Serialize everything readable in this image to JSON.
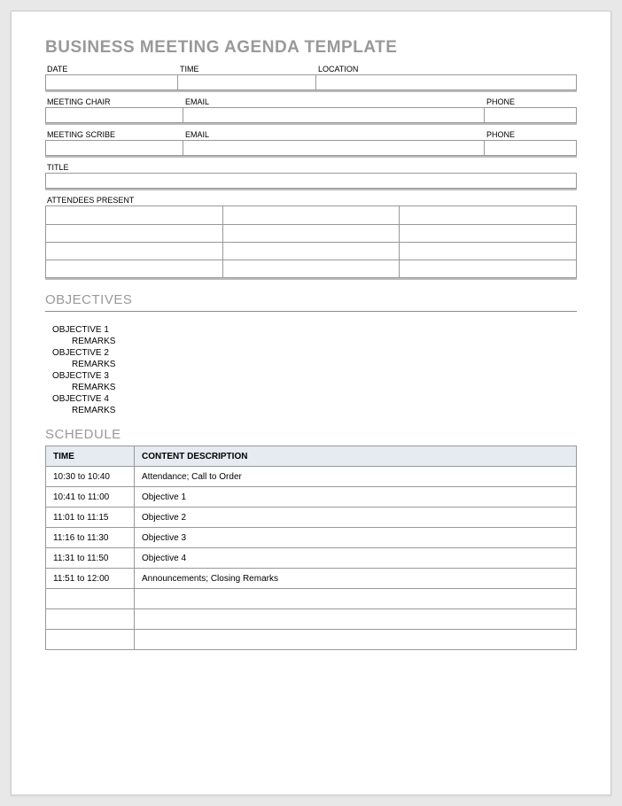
{
  "title": "BUSINESS MEETING AGENDA TEMPLATE",
  "header": {
    "date_label": "DATE",
    "time_label": "TIME",
    "location_label": "LOCATION",
    "date": "",
    "time": "",
    "location": "",
    "chair_label": "MEETING CHAIR",
    "email_label": "EMAIL",
    "phone_label": "PHONE",
    "chair": "",
    "chair_email": "",
    "chair_phone": "",
    "scribe_label": "MEETING SCRIBE",
    "scribe": "",
    "scribe_email": "",
    "scribe_phone": "",
    "title_label": "TITLE",
    "title_value": "",
    "attendees_label": "ATTENDEES PRESENT"
  },
  "objectives_heading": "OBJECTIVES",
  "objectives": [
    {
      "name": "OBJECTIVE 1",
      "remarks_label": "REMARKS"
    },
    {
      "name": "OBJECTIVE 2",
      "remarks_label": "REMARKS"
    },
    {
      "name": "OBJECTIVE 3",
      "remarks_label": "REMARKS"
    },
    {
      "name": "OBJECTIVE 4",
      "remarks_label": "REMARKS"
    }
  ],
  "schedule_heading": "SCHEDULE",
  "schedule": {
    "col_time": "TIME",
    "col_desc": "CONTENT DESCRIPTION",
    "rows": [
      {
        "time": "10:30 to 10:40",
        "desc": "Attendance; Call to Order"
      },
      {
        "time": "10:41 to 11:00",
        "desc": "Objective 1"
      },
      {
        "time": "11:01 to 11:15",
        "desc": "Objective 2"
      },
      {
        "time": "11:16 to 11:30",
        "desc": "Objective 3"
      },
      {
        "time": "11:31 to 11:50",
        "desc": "Objective 4"
      },
      {
        "time": "11:51 to 12:00",
        "desc": "Announcements; Closing Remarks"
      },
      {
        "time": "",
        "desc": ""
      },
      {
        "time": "",
        "desc": ""
      },
      {
        "time": "",
        "desc": ""
      }
    ]
  }
}
